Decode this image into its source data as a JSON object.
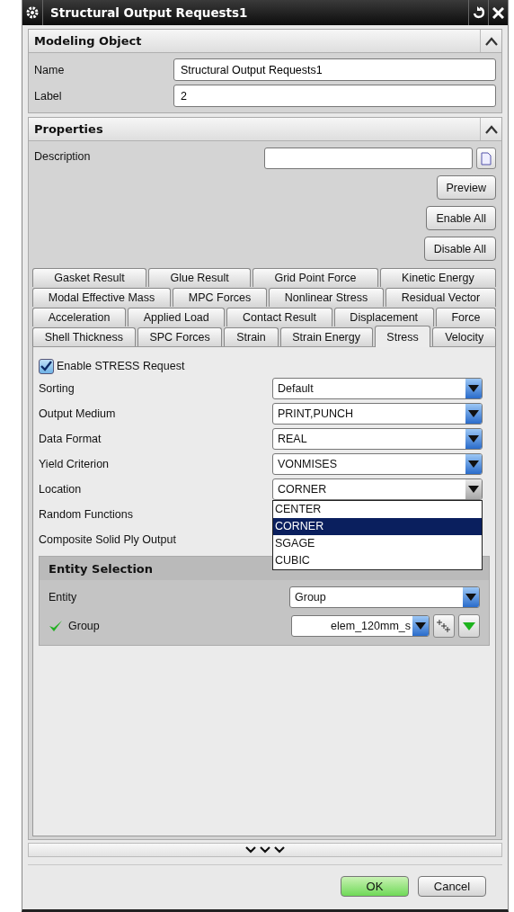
{
  "window": {
    "title": "Structural Output Requests1"
  },
  "modeling_object": {
    "title": "Modeling Object",
    "expanded": true,
    "fields": [
      {
        "label": "Name",
        "value": "Structural Output Requests1"
      },
      {
        "label": "Label",
        "value": "2"
      }
    ]
  },
  "properties": {
    "title": "Properties",
    "expanded": true,
    "description": {
      "label": "Description"
    },
    "buttons": [
      "Preview",
      "Enable All",
      "Disable All"
    ],
    "tab_rows": [
      [
        {
          "label": "Gasket Result",
          "selected": false
        },
        {
          "label": "Glue Result",
          "selected": false
        },
        {
          "label": "Grid Point Force",
          "selected": false
        },
        {
          "label": "Kinetic Energy",
          "selected": false
        }
      ],
      [
        {
          "label": "Modal Effective Mass",
          "selected": false
        },
        {
          "label": "MPC Forces",
          "selected": false
        },
        {
          "label": "Nonlinear Stress",
          "selected": false
        },
        {
          "label": "Residual Vector",
          "selected": false
        }
      ],
      [
        {
          "label": "Acceleration",
          "selected": false
        },
        {
          "label": "Applied Load",
          "selected": false
        },
        {
          "label": "Contact Result",
          "selected": false
        },
        {
          "label": "Displacement",
          "selected": false
        },
        {
          "label": "Force",
          "selected": false
        }
      ],
      [
        {
          "label": "Shell Thickness",
          "selected": false
        },
        {
          "label": "SPC Forces",
          "selected": false
        },
        {
          "label": "Strain",
          "selected": false
        },
        {
          "label": "Strain Energy",
          "selected": false
        },
        {
          "label": "Stress",
          "selected": true
        },
        {
          "label": "Velocity",
          "selected": false
        }
      ]
    ],
    "enable": {
      "label": "Enable STRESS Request",
      "checked": true
    },
    "rows": [
      {
        "label": "Sorting",
        "kind": "dropdown",
        "value": "Default",
        "expanded": false
      },
      {
        "label": "Output Medium",
        "kind": "dropdown",
        "value": "PRINT,PUNCH",
        "expanded": false
      },
      {
        "label": "Data Format",
        "kind": "dropdown",
        "value": "REAL",
        "expanded": false
      },
      {
        "label": "Yield Criterion",
        "kind": "dropdown",
        "value": "VONMISES",
        "expanded": false
      },
      {
        "label": "Location",
        "kind": "dropdown",
        "value": "CORNER",
        "expanded": true,
        "options": [
          {
            "label": "CENTER",
            "selected": false
          },
          {
            "label": "CORNER",
            "selected": true
          },
          {
            "label": "SGAGE",
            "selected": false
          },
          {
            "label": "CUBIC",
            "selected": false
          }
        ]
      },
      {
        "label": "Random Functions",
        "kind": "label"
      },
      {
        "label": "Composite Solid Ply Output",
        "kind": "label"
      }
    ],
    "entity_selection": {
      "title": "Entity Selection",
      "rows": [
        {
          "label": "Entity",
          "kind": "dropdown",
          "value": "Group"
        },
        {
          "label": "Group",
          "kind": "group",
          "value": "elem_120mm_s",
          "valid": true
        }
      ]
    }
  },
  "footer": {
    "buttons": [
      {
        "label": "OK",
        "kind": "primary"
      },
      {
        "label": "Cancel",
        "kind": "normal"
      }
    ]
  }
}
